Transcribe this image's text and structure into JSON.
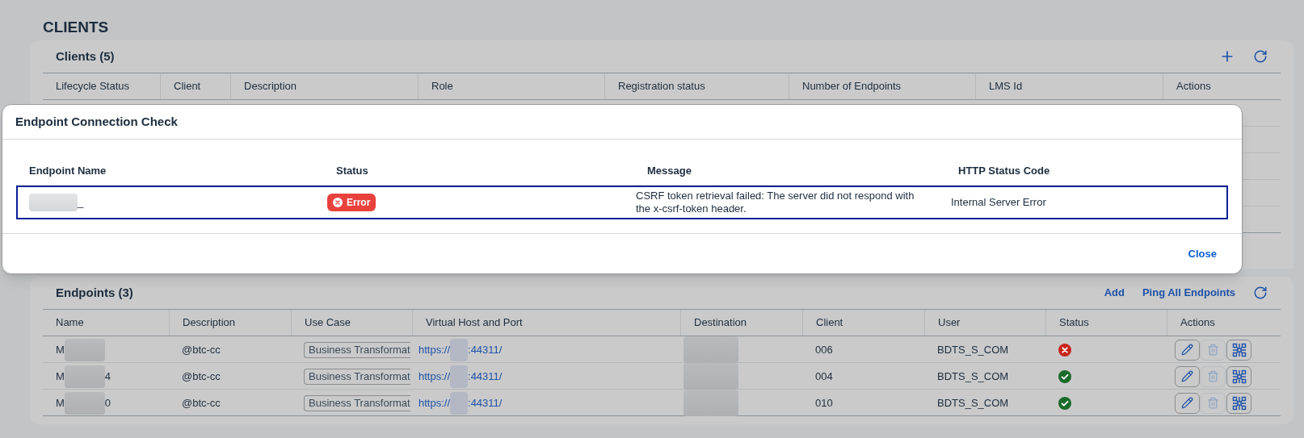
{
  "page_title": "CLIENTS",
  "clients_panel": {
    "title": "Clients (5)",
    "columns": [
      "Lifecycle Status",
      "Client",
      "Description",
      "Role",
      "Registration status",
      "Number of Endpoints",
      "LMS Id",
      "Actions"
    ]
  },
  "dialog": {
    "title": "Endpoint Connection Check",
    "columns": [
      "Endpoint Name",
      "Status",
      "Message",
      "HTTP Status Code"
    ],
    "rows": [
      {
        "name_end": "_",
        "status": {
          "kind": "error",
          "label": "Error"
        },
        "message": "CSRF token retrieval failed: The server did not respond with the x-csrf-token header.",
        "http_status": "Internal Server Error",
        "selected": true
      }
    ],
    "close": "Close"
  },
  "endpoints_panel": {
    "title": "Endpoints (3)",
    "actions": [
      "Add",
      "Ping All Endpoints"
    ],
    "columns": [
      "Name",
      "Description",
      "Use Case",
      "Virtual Host and Port",
      "Destination",
      "Client",
      "User",
      "Status",
      "Actions"
    ],
    "rows": [
      {
        "name_start": "M",
        "description": "@btc-cc",
        "use_case": "Business Transformat",
        "url_start": "https://",
        "url_end": ":44311/",
        "client": "006",
        "user": "BDTS_S_COM",
        "status": {
          "kind": "error"
        }
      },
      {
        "name_start": "M",
        "name_end": "4",
        "description": "@btc-cc",
        "use_case": "Business Transformat",
        "url_start": "https://",
        "url_end": ":44311/",
        "client": "004",
        "user": "BDTS_S_COM",
        "status": {
          "kind": "success"
        }
      },
      {
        "name_start": "M",
        "name_end": "0",
        "description": "@btc-cc",
        "use_case": "Business Transformat",
        "url_start": "https://",
        "url_end": ":44311/",
        "client": "010",
        "user": "BDTS_S_COM",
        "status": {
          "kind": "success"
        }
      }
    ]
  }
}
